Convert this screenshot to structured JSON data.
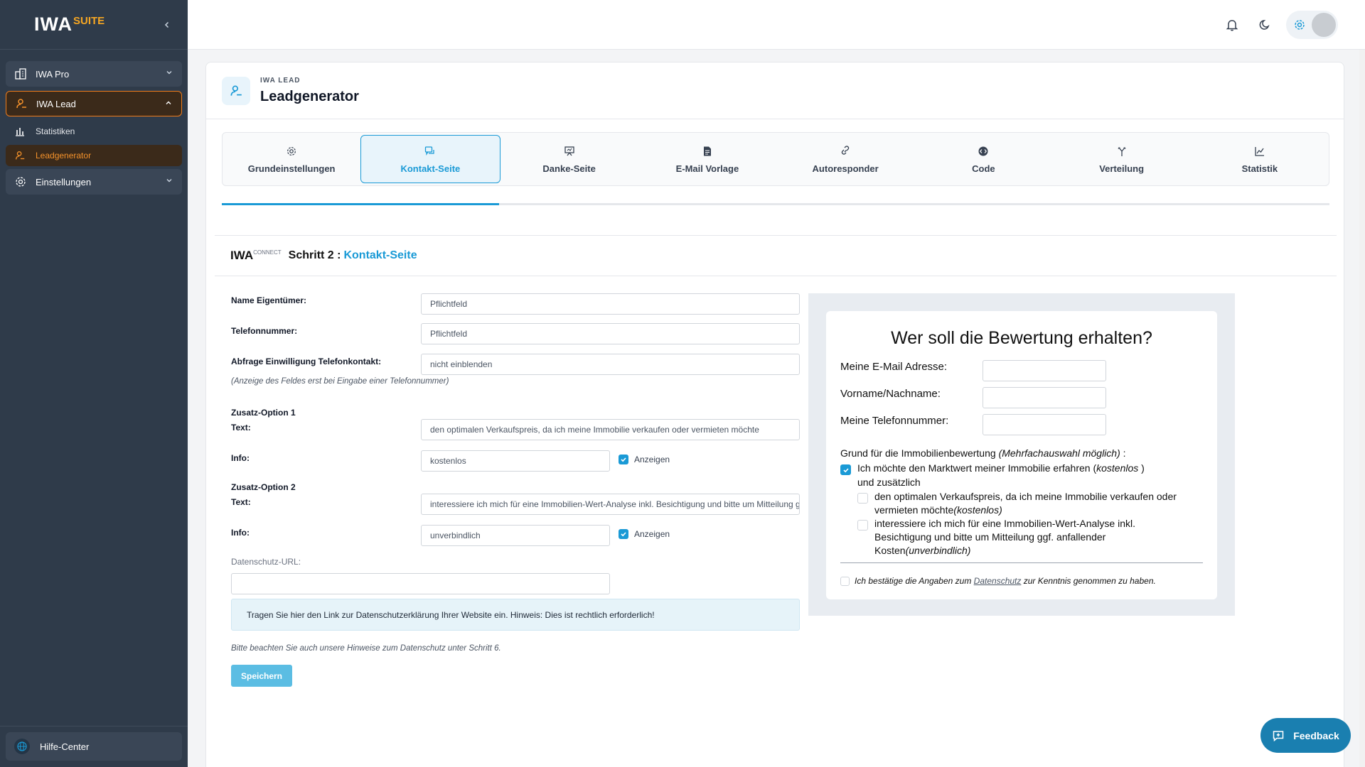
{
  "brand": {
    "main": "IWA",
    "suite": "SUITE"
  },
  "sidebar": {
    "items": [
      {
        "label": "IWA Pro",
        "icon": "building-icon"
      },
      {
        "label": "IWA Lead",
        "icon": "user-key-icon"
      },
      {
        "label": "Einstellungen",
        "icon": "gear-icon"
      }
    ],
    "subitems": [
      {
        "label": "Statistiken",
        "icon": "bar-chart-icon"
      },
      {
        "label": "Leadgenerator",
        "icon": "user-key-icon"
      }
    ],
    "help": "Hilfe-Center"
  },
  "header": {
    "overline": "IWA LEAD",
    "title": "Leadgenerator"
  },
  "tabs": [
    {
      "label": "Grundeinstellungen",
      "icon": "gear-icon"
    },
    {
      "label": "Kontakt-Seite",
      "icon": "chat-icon"
    },
    {
      "label": "Danke-Seite",
      "icon": "presentation-icon"
    },
    {
      "label": "E-Mail Vorlage",
      "icon": "document-icon"
    },
    {
      "label": "Autoresponder",
      "icon": "link-icon"
    },
    {
      "label": "Code",
      "icon": "code-icon"
    },
    {
      "label": "Verteilung",
      "icon": "split-icon"
    },
    {
      "label": "Statistik",
      "icon": "line-chart-icon"
    }
  ],
  "step_progress": 0.25,
  "step": {
    "brand_main": "IWA",
    "brand_sub": "CONNECT",
    "label": "Schritt 2 :",
    "name": "Kontakt-Seite"
  },
  "form": {
    "name_owner_label": "Name Eigentümer:",
    "name_owner_value": "Pflichtfeld",
    "phone_label": "Telefonnummer:",
    "phone_value": "Pflichtfeld",
    "consent_label": "Abfrage Einwilligung Telefonkontakt:",
    "consent_value": "nicht einblenden",
    "consent_note": "(Anzeige des Feldes erst bei Eingabe einer Telefonnummer)",
    "option1_title": "Zusatz-Option 1",
    "option1_text_label": "Text:",
    "option1_text": "den optimalen Verkaufspreis, da ich meine Immobilie verkaufen oder vermieten möchte",
    "option1_info_label": "Info:",
    "option1_info": "kostenlos",
    "option1_show": "Anzeigen",
    "option2_title": "Zusatz-Option 2",
    "option2_text_label": "Text:",
    "option2_text": "interessiere ich mich für eine Immobilien-Wert-Analyse inkl. Besichtigung und bitte um Mitteilung ggf. anfallender Kosten",
    "option2_info_label": "Info:",
    "option2_info": "unverbindlich",
    "option2_show": "Anzeigen",
    "privacy_label": "Datenschutz-URL:",
    "privacy_value": "",
    "privacy_hint": "Tragen Sie hier den Link zur Datenschutzerklärung Ihrer Website ein. Hinweis: Dies ist rechtlich erforderlich!",
    "privacy_note": "Bitte beachten Sie auch unsere Hinweise zum Datenschutz unter Schritt 6.",
    "save": "Speichern"
  },
  "preview": {
    "title": "Wer soll die Bewertung erhalten?",
    "email_label": "Meine E-Mail Adresse:",
    "name_label": "Vorname/Nachname:",
    "phone_label": "Meine Telefonnummer:",
    "reason_prefix": "Grund für die Immobilienbewertung ",
    "reason_italic": "(Mehrfachauswahl möglich)",
    "reason_suffix": " :",
    "opt_main_text": "Ich möchte den Marktwert meiner Immobilie erfahren (",
    "opt_main_italic": "kostenlos",
    "opt_main_end": " )",
    "and_more": "und zusätzlich",
    "opt1_line1": "den optimalen Verkaufspreis, da ich meine Immobilie verkaufen oder",
    "opt1_line2": "vermieten möchte",
    "opt1_italic": "(kostenlos)",
    "opt2_line1": "interessiere ich mich für eine Immobilien-Wert-Analyse inkl.",
    "opt2_line2": "Besichtigung und bitte um Mitteilung ggf. anfallender",
    "opt2_line3": "Kosten",
    "opt2_italic": "(unverbindlich)",
    "confirm_pre": "Ich bestätige die Angaben zum ",
    "confirm_link": "Datenschutz",
    "confirm_post": " zur Kenntnis genommen zu haben."
  },
  "feedback": "Feedback",
  "colors": {
    "accent": "#1a9ad6",
    "orange": "#f5922b",
    "sidebar": "#2f3b4a"
  }
}
